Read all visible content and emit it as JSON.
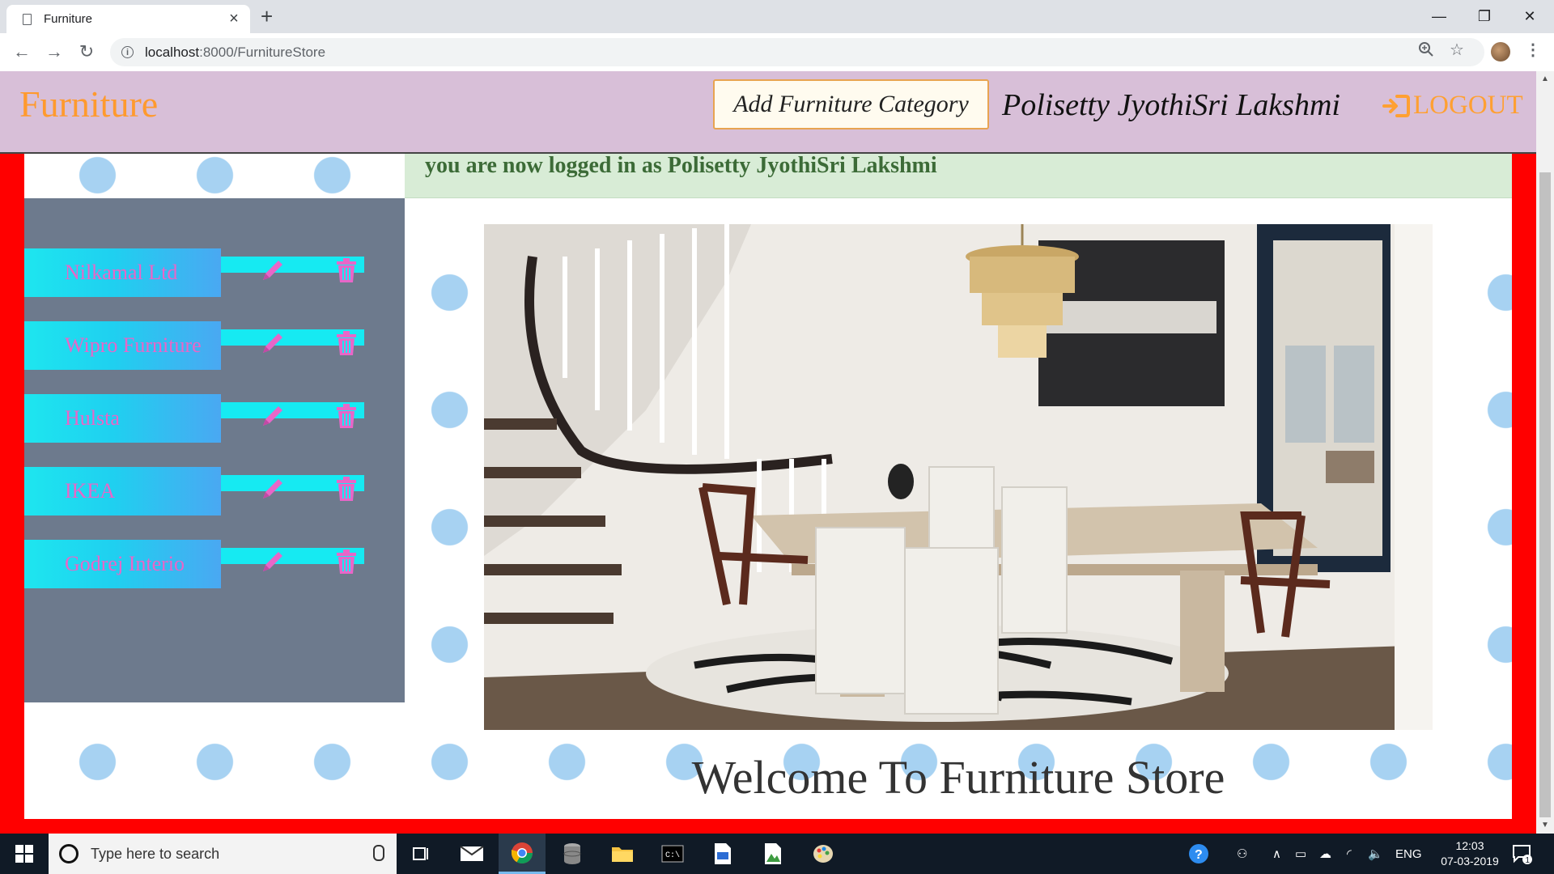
{
  "browser": {
    "tab_title": "Furniture",
    "url_host": "localhost",
    "url_rest": ":8000/FurnitureStore"
  },
  "header": {
    "brand": "Furniture",
    "add_category_label": "Add Furniture Category",
    "username": "Polisetty JyothiSri Lakshmi",
    "logout_label": "LOGOUT"
  },
  "alert": {
    "message": "you are now logged in as Polisetty JyothiSri Lakshmi"
  },
  "categories": [
    {
      "name": "Nilkamal Ltd"
    },
    {
      "name": "Wipro Furniture"
    },
    {
      "name": "Hulsta"
    },
    {
      "name": "IKEA"
    },
    {
      "name": "Godrej Interio"
    }
  ],
  "main": {
    "welcome": "Welcome To Furniture Store"
  },
  "taskbar": {
    "search_placeholder": "Type here to search",
    "language": "ENG",
    "time": "12:03",
    "date": "07-03-2019",
    "notification_count": "1"
  },
  "colors": {
    "page_border": "#ff0000",
    "header_bg": "#d8bfd8",
    "brand": "#ff9a2e",
    "alert_bg": "#d8ecd6",
    "alert_text": "#3c6b37",
    "sidebar_bg": "#6d7a8d",
    "category_text": "#e866c8",
    "polka_dot": "#a7d2f2"
  }
}
